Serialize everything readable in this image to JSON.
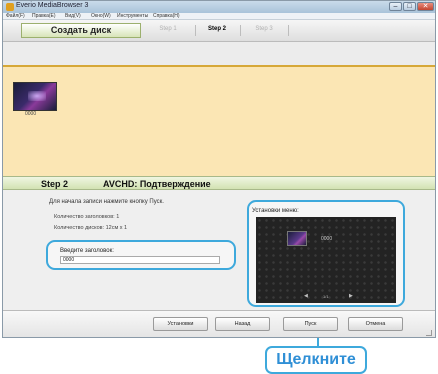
{
  "window": {
    "title": "Everio MediaBrowser 3",
    "controls": {
      "minimize": "–",
      "maximize": "□",
      "close": "✕"
    }
  },
  "menubar": {
    "items": [
      "Файл(F)",
      "Правка(E)",
      "Вид(V)",
      "Окно(W)",
      "Инструменты",
      "Справка(H)"
    ]
  },
  "stepbar": {
    "create_disc": "Создать диск",
    "steps": [
      "Step 1",
      "Step 2",
      "Step 3"
    ],
    "active_step": "Step 2"
  },
  "content": {
    "thumb_label": "0000"
  },
  "header2": {
    "step": "Step 2",
    "title": "AVCHD: Подтверждение"
  },
  "panel": {
    "instruction": "Для начала записи нажмите кнопку Пуск.",
    "titles_count": "Количество заголовков: 1",
    "discs_count": "Количество дисков: 12см x 1",
    "title_label": "Введите заголовок:",
    "title_value": "0000"
  },
  "menu_settings": {
    "label": "Установки меню:",
    "preview_title": "0000",
    "prev": "◀",
    "page": "1/1",
    "next": "▶"
  },
  "buttons": {
    "settings": "Установки",
    "back": "Назад",
    "start": "Пуск",
    "cancel": "Отмена"
  },
  "callout": {
    "text": "Щелкните"
  },
  "colors": {
    "highlight": "#3ea9dc",
    "content_bg": "#fbe6b4",
    "header_bg": "#d2e2b2"
  }
}
